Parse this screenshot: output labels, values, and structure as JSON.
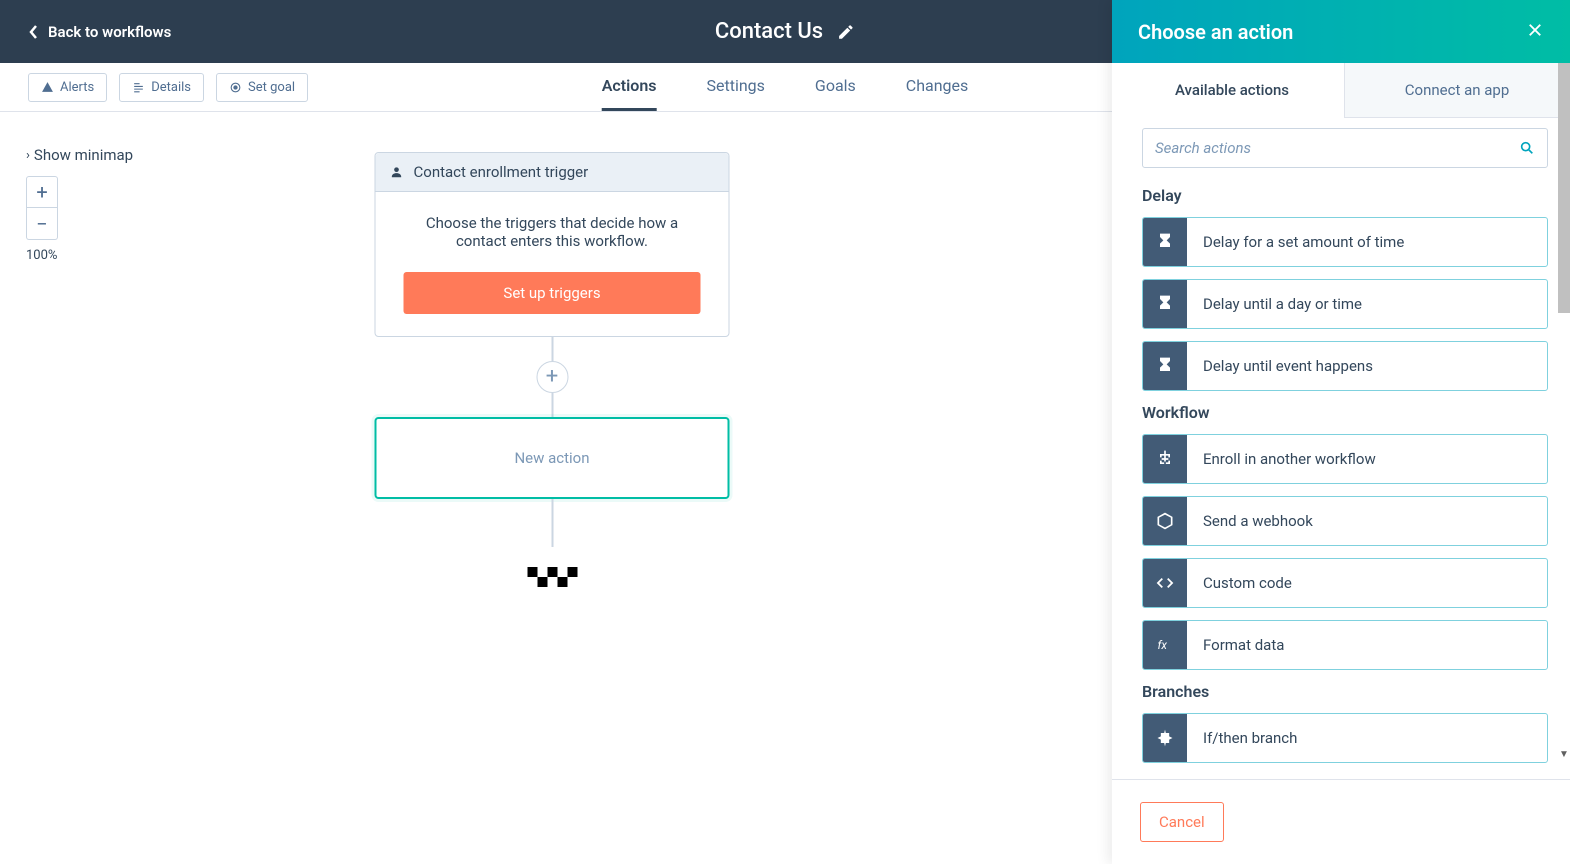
{
  "topbar": {
    "back": "Back to workflows",
    "title": "Contact Us"
  },
  "toolbar": {
    "alerts": "Alerts",
    "details": "Details",
    "setgoal": "Set goal"
  },
  "tabs": {
    "actions": "Actions",
    "settings": "Settings",
    "goals": "Goals",
    "changes": "Changes"
  },
  "minimap": {
    "label": "Show minimap",
    "zoom_pct": "100%"
  },
  "trigger": {
    "title": "Contact enrollment trigger",
    "desc": "Choose the triggers that decide how a contact enters this workflow.",
    "button": "Set up triggers"
  },
  "new_action": "New action",
  "panel": {
    "title": "Choose an action",
    "tab_available": "Available actions",
    "tab_connect": "Connect an app",
    "search_placeholder": "Search actions",
    "groups": [
      {
        "name": "Delay",
        "items": [
          {
            "icon": "hourglass",
            "label": "Delay for a set amount of time"
          },
          {
            "icon": "hourglass",
            "label": "Delay until a day or time"
          },
          {
            "icon": "hourglass",
            "label": "Delay until event happens"
          }
        ]
      },
      {
        "name": "Workflow",
        "items": [
          {
            "icon": "sitemap",
            "label": "Enroll in another workflow"
          },
          {
            "icon": "cube",
            "label": "Send a webhook"
          },
          {
            "icon": "code",
            "label": "Custom code"
          },
          {
            "icon": "fx",
            "label": "Format data"
          }
        ]
      },
      {
        "name": "Branches",
        "items": [
          {
            "icon": "branch",
            "label": "If/then branch"
          }
        ]
      }
    ],
    "cancel": "Cancel"
  }
}
